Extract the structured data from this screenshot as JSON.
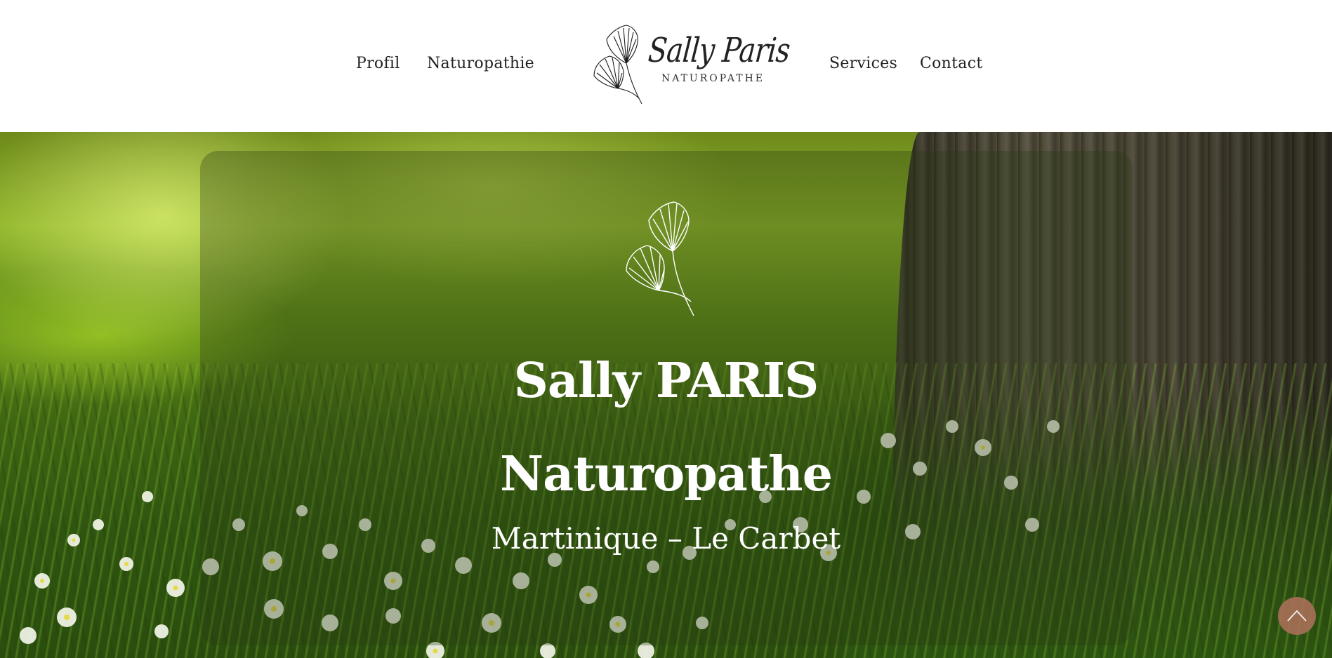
{
  "nav": {
    "left": [
      {
        "label": "Profil"
      },
      {
        "label": "Naturopathie"
      }
    ],
    "right": [
      {
        "label": "Services"
      },
      {
        "label": "Contact"
      }
    ]
  },
  "logo": {
    "name": "Sally Paris",
    "tagline": "NATUROPATHE",
    "icon": "ginkgo-leaf-icon"
  },
  "hero": {
    "icon": "ginkgo-leaf-icon",
    "title_line1": "Sally PARIS",
    "title_line2": "Naturopathe",
    "subtitle": "Martinique – Le Carbet"
  },
  "scroll_top": {
    "icon": "chevron-up-icon",
    "color": "#a66f56"
  }
}
